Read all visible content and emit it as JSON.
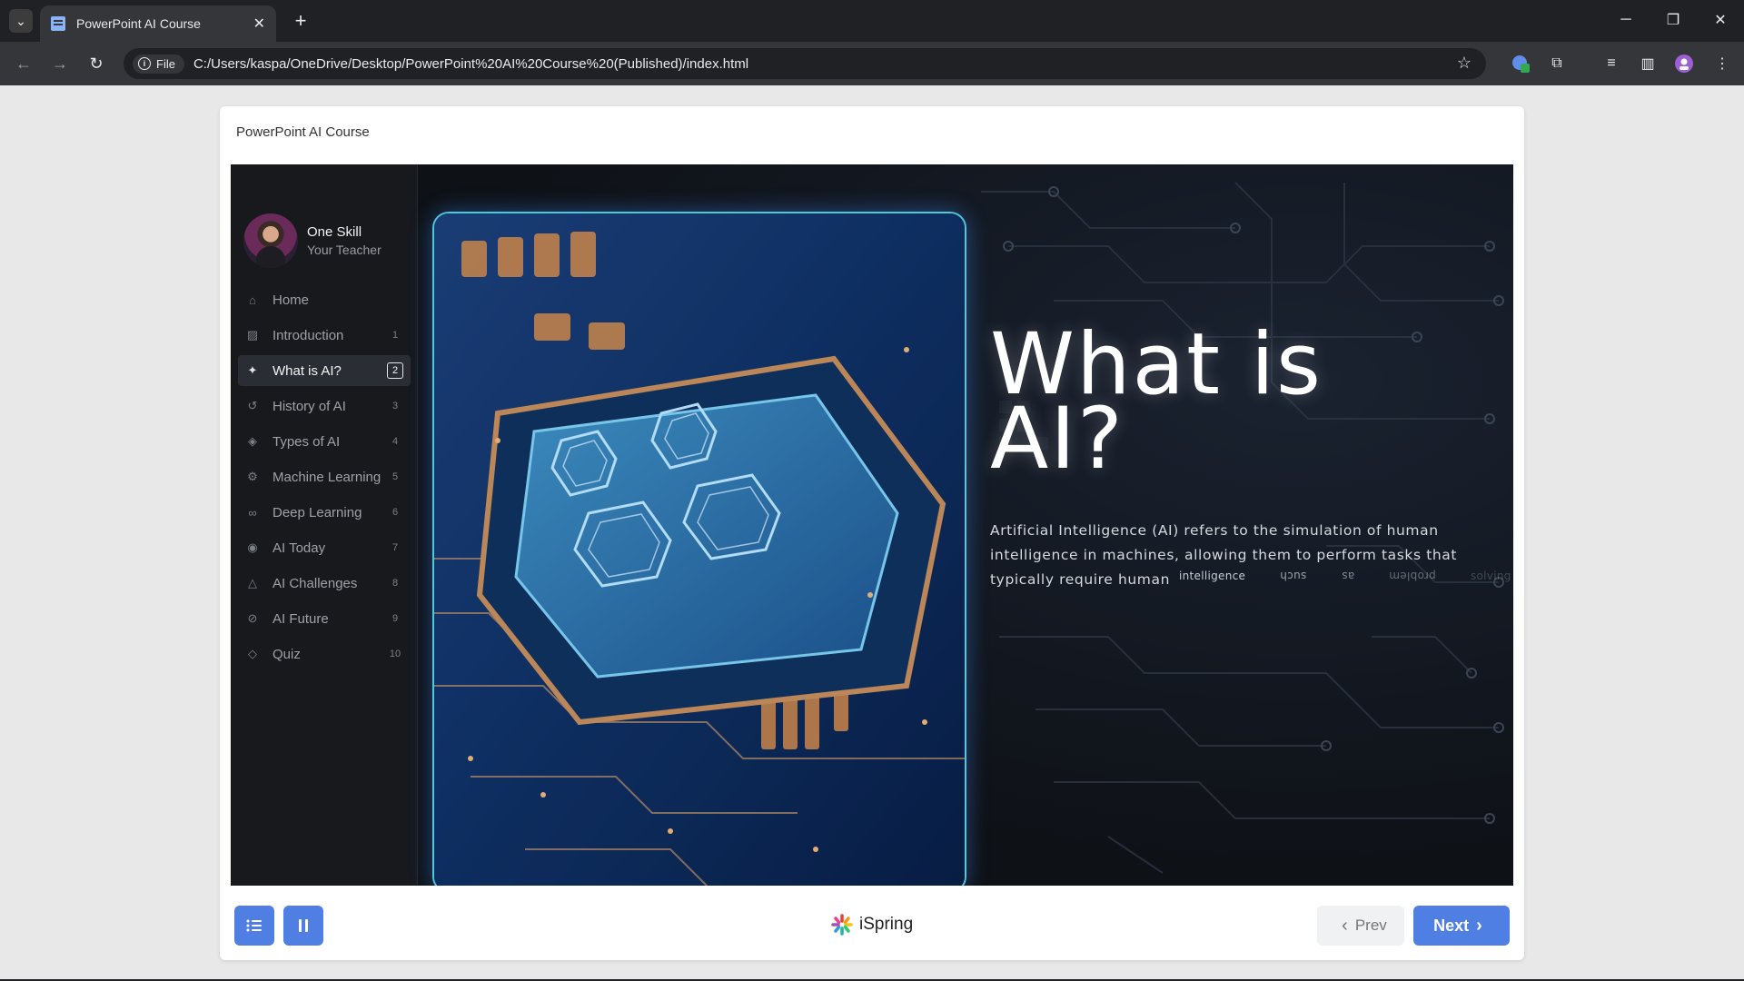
{
  "browser": {
    "tab_title": "PowerPoint AI Course",
    "tab_close": "✕",
    "new_tab": "+",
    "file_chip": "File",
    "url": "C:/Users/kaspa/OneDrive/Desktop/PowerPoint%20AI%20Course%20(Published)/index.html"
  },
  "player": {
    "course_title": "PowerPoint AI Course",
    "teacher": {
      "name": "One Skill",
      "role": "Your Teacher"
    },
    "menu": [
      {
        "label": "Home",
        "num": "",
        "icon": "home-icon"
      },
      {
        "label": "Introduction",
        "num": "1",
        "icon": "image-icon"
      },
      {
        "label": "What is AI?",
        "num": "2",
        "icon": "sparkle-icon",
        "active": true
      },
      {
        "label": "History of AI",
        "num": "3",
        "icon": "history-icon"
      },
      {
        "label": "Types of AI",
        "num": "4",
        "icon": "layers-icon"
      },
      {
        "label": "Machine Learning",
        "num": "5",
        "icon": "gear-icon"
      },
      {
        "label": "Deep Learning",
        "num": "6",
        "icon": "binoculars-icon"
      },
      {
        "label": "AI Today",
        "num": "7",
        "icon": "location-icon"
      },
      {
        "label": "AI Challenges",
        "num": "8",
        "icon": "warning-icon"
      },
      {
        "label": "AI Future",
        "num": "9",
        "icon": "orbit-icon"
      },
      {
        "label": "Quiz",
        "num": "10",
        "icon": "graduation-cap-icon"
      }
    ],
    "slide": {
      "title": "What is AI?",
      "body": "Artificial Intelligence (AI) refers to the simulation of human intelligence in machines, allowing them to perform tasks that typically require human",
      "animating_words": [
        "intelligence",
        "such",
        "as",
        "problem",
        "solving"
      ]
    },
    "controls": {
      "brand": "iSpring",
      "prev_label": "Prev",
      "next_label": "Next"
    },
    "colors": {
      "accent": "#4f7fe3",
      "card_border": "#4fc9d8"
    }
  }
}
